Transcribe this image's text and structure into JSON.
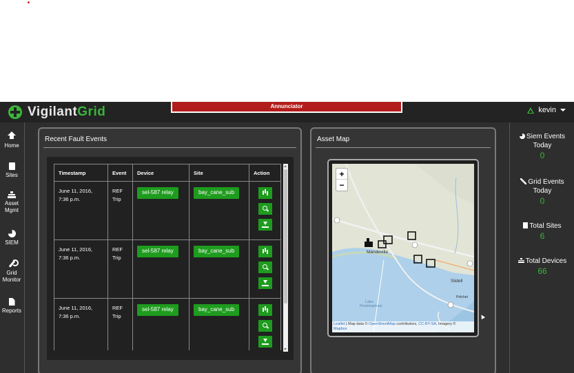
{
  "app": {
    "logo": {
      "part1": "Vigilant",
      "part2": "Grid"
    },
    "annunciator": "Annunciator",
    "user": "kevin"
  },
  "nav": [
    {
      "label_line1": "Home",
      "label_line2": "",
      "icon": "home-icon"
    },
    {
      "label_line1": "Sites",
      "label_line2": "",
      "icon": "sites-icon"
    },
    {
      "label_line1": "Asset",
      "label_line2": "Mgmt",
      "icon": "sitemap-icon"
    },
    {
      "label_line1": "SIEM",
      "label_line2": "",
      "icon": "pie-chart-icon"
    },
    {
      "label_line1": "Grid",
      "label_line2": "Monitor",
      "icon": "wrench-icon"
    },
    {
      "label_line1": "Reports",
      "label_line2": "",
      "icon": "document-icon"
    }
  ],
  "stats": [
    {
      "label_line1": "Siem Events",
      "label_line2": "Today",
      "value": "0",
      "icon": "pie-chart-icon"
    },
    {
      "label_line1": "Grid Events",
      "label_line2": "Today",
      "value": "0",
      "icon": "wrench-icon"
    },
    {
      "label_line1": "Total Sites",
      "label_line2": "",
      "value": "6",
      "icon": "building-icon"
    },
    {
      "label_line1": "Total Devices",
      "label_line2": "",
      "value": "66",
      "icon": "sitemap-icon"
    }
  ],
  "fault_panel": {
    "title": "Recent Fault Events",
    "columns": [
      "Timestamp",
      "Event",
      "Device",
      "Site",
      "Action"
    ],
    "rows": [
      {
        "timestamp_line1": "June 11, 2016,",
        "timestamp_line2": "7:36 p.m.",
        "event_line1": "REF",
        "event_line2": "Trip",
        "device": "sel-587 relay",
        "site": "bay_cane_sub"
      },
      {
        "timestamp_line1": "June 11, 2016,",
        "timestamp_line2": "7:36 p.m.",
        "event_line1": "REF",
        "event_line2": "Trip",
        "device": "sel-587 relay",
        "site": "bay_cane_sub"
      },
      {
        "timestamp_line1": "June 11, 2016,",
        "timestamp_line2": "7:36 p.m.",
        "event_line1": "REF",
        "event_line2": "Trip",
        "device": "sel-587 relay",
        "site": "bay_cane_sub"
      }
    ]
  },
  "map_panel": {
    "title": "Asset Map",
    "zoom_in": "+",
    "zoom_out": "−",
    "labels": {
      "city1": "Mandeville",
      "city2": "Slidell",
      "city3": "Pritchet",
      "lake_line1": "Lake",
      "lake_line2": "Pontchartrain"
    },
    "attribution": {
      "leaflet": "Leaflet",
      "text1": " | Map data © ",
      "osm": "OpenStreetMap",
      "text2": " contributors, ",
      "license": "CC-BY-SA",
      "text3": ", Imagery ©",
      "mapbox": "Mapbox"
    }
  },
  "colors": {
    "accent": "#3ab53a",
    "button": "#1e9c1e",
    "annunciator": "#b31c1c",
    "background": "#2e2e2e"
  }
}
